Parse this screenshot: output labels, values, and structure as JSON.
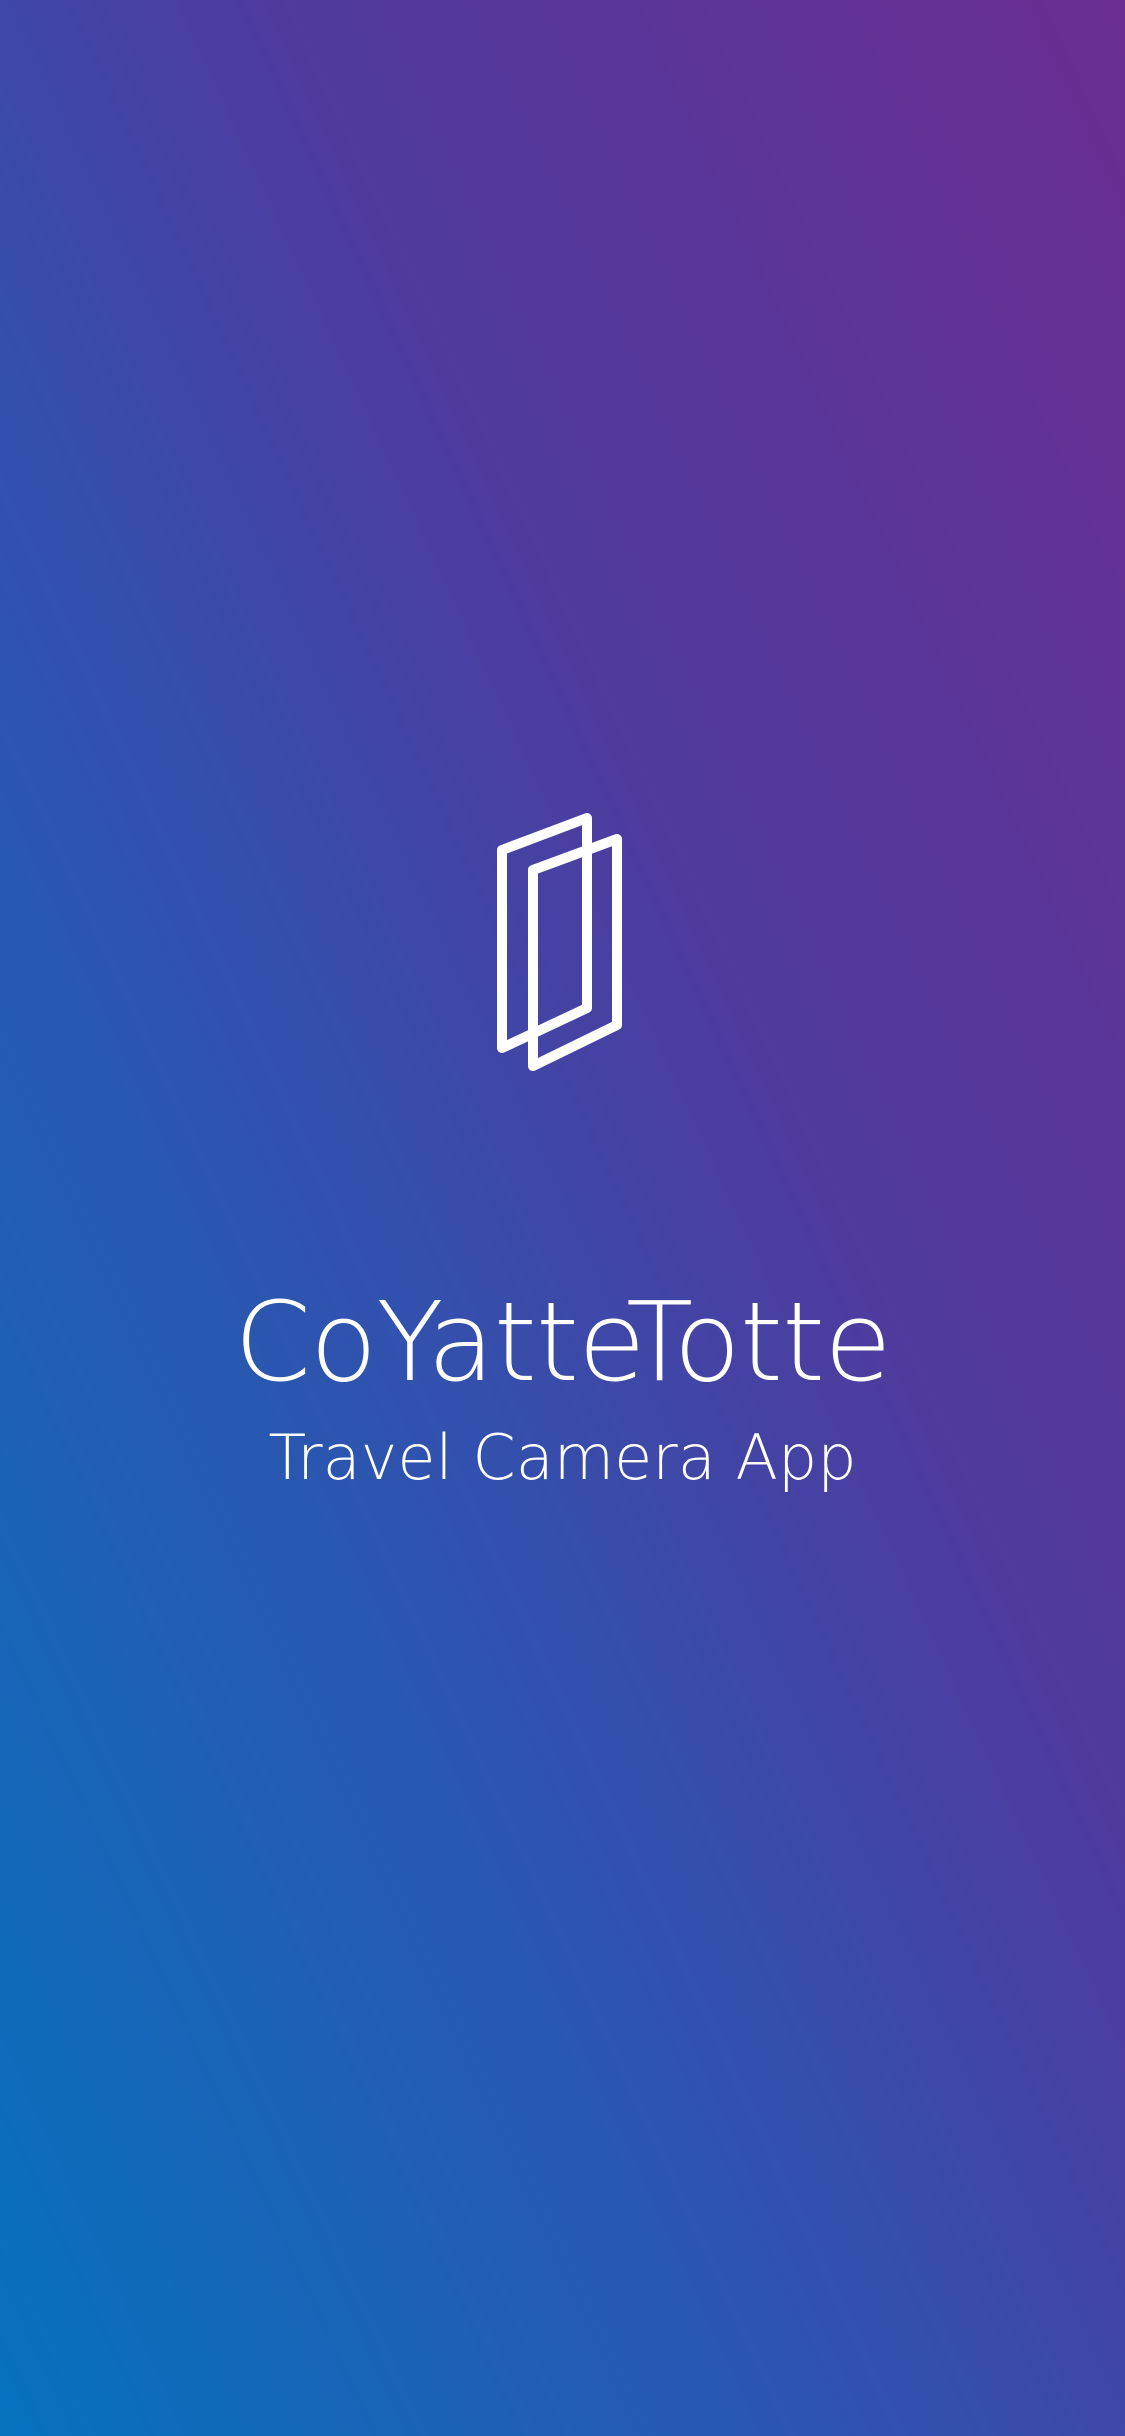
{
  "splash": {
    "logo_icon": "overlapping-frames-icon",
    "title": "CoYatteTotte",
    "subtitle": "Travel Camera App"
  },
  "colors": {
    "gradient_bottom_left": "#0572be",
    "gradient_middle": "#3350ad",
    "gradient_top_right": "#6a2d91",
    "text": "#ffffff"
  }
}
